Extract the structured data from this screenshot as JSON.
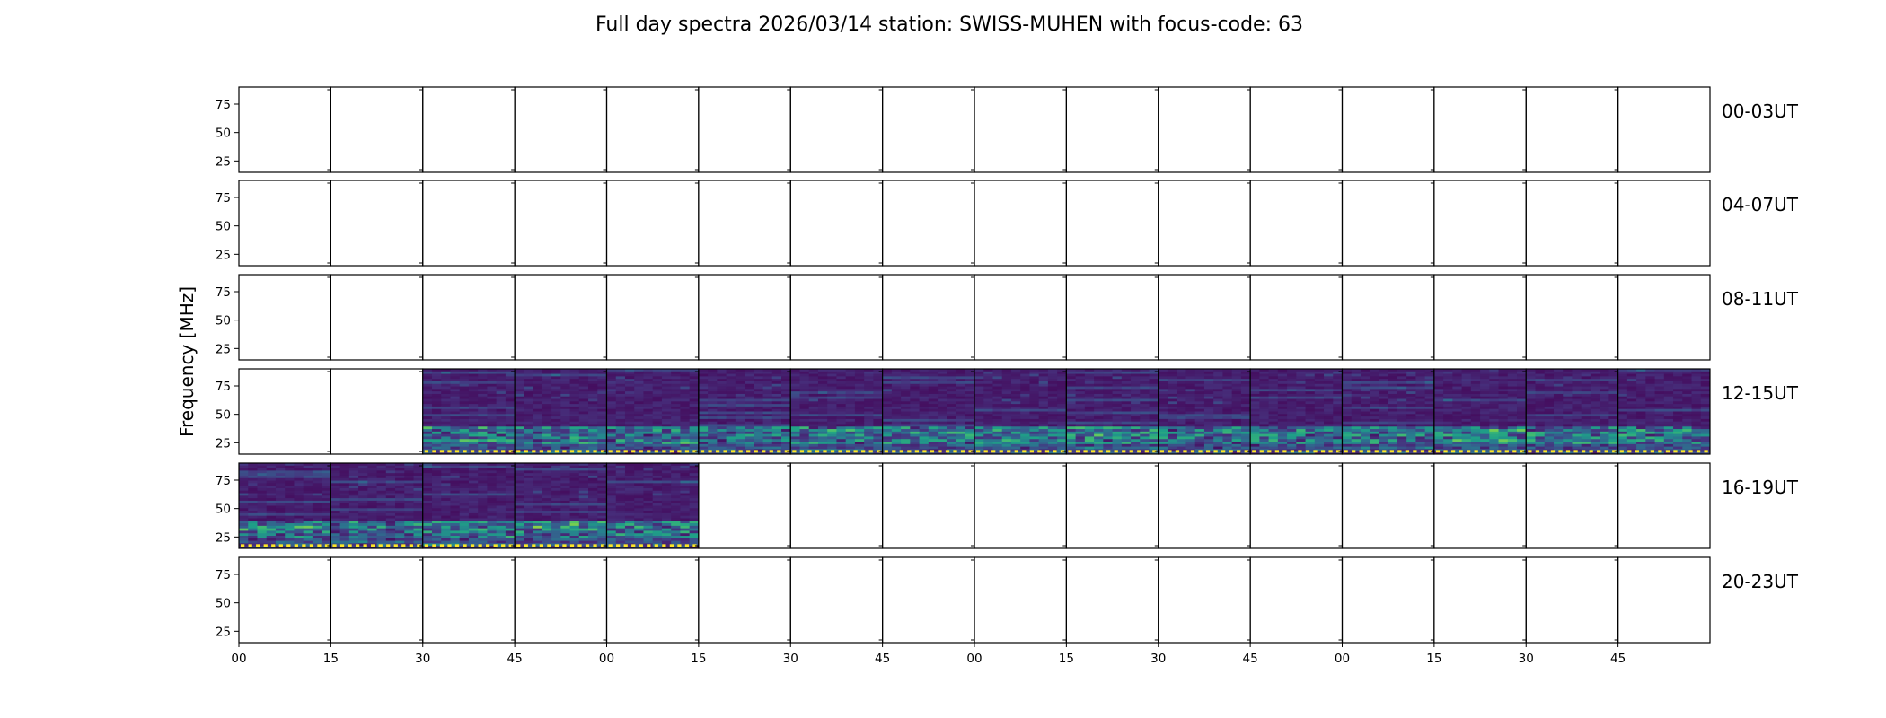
{
  "chart_data": {
    "type": "heatmap",
    "title": "Full day spectra 2026/03/14 station: SWISS-MUHEN with focus-code: 63",
    "ylabel": "Frequency [MHz]",
    "ylim": [
      15,
      90
    ],
    "yticks": [
      "75",
      "50",
      "25"
    ],
    "ytick_values": [
      75,
      50,
      25
    ],
    "xtick_labels": [
      "00",
      "15",
      "30",
      "45",
      "00",
      "15",
      "30",
      "45",
      "00",
      "15",
      "30",
      "45",
      "00",
      "15",
      "30",
      "45"
    ],
    "row_labels": [
      "00-03UT",
      "04-07UT",
      "08-11UT",
      "12-15UT",
      "16-19UT",
      "20-23UT"
    ],
    "segments_per_row": 16,
    "segment_minutes": 15,
    "colormap": [
      "#440154",
      "#46327e",
      "#365c8d",
      "#277f8e",
      "#1fa187",
      "#4ac16d",
      "#a0da39",
      "#fde725"
    ],
    "segments_with_data": [
      {
        "row": 3,
        "cols": [
          2,
          3,
          4,
          5,
          6,
          7,
          8,
          9,
          10,
          11,
          12,
          13,
          14,
          15
        ]
      },
      {
        "row": 4,
        "cols": [
          0,
          1,
          2,
          3,
          4
        ]
      }
    ]
  }
}
